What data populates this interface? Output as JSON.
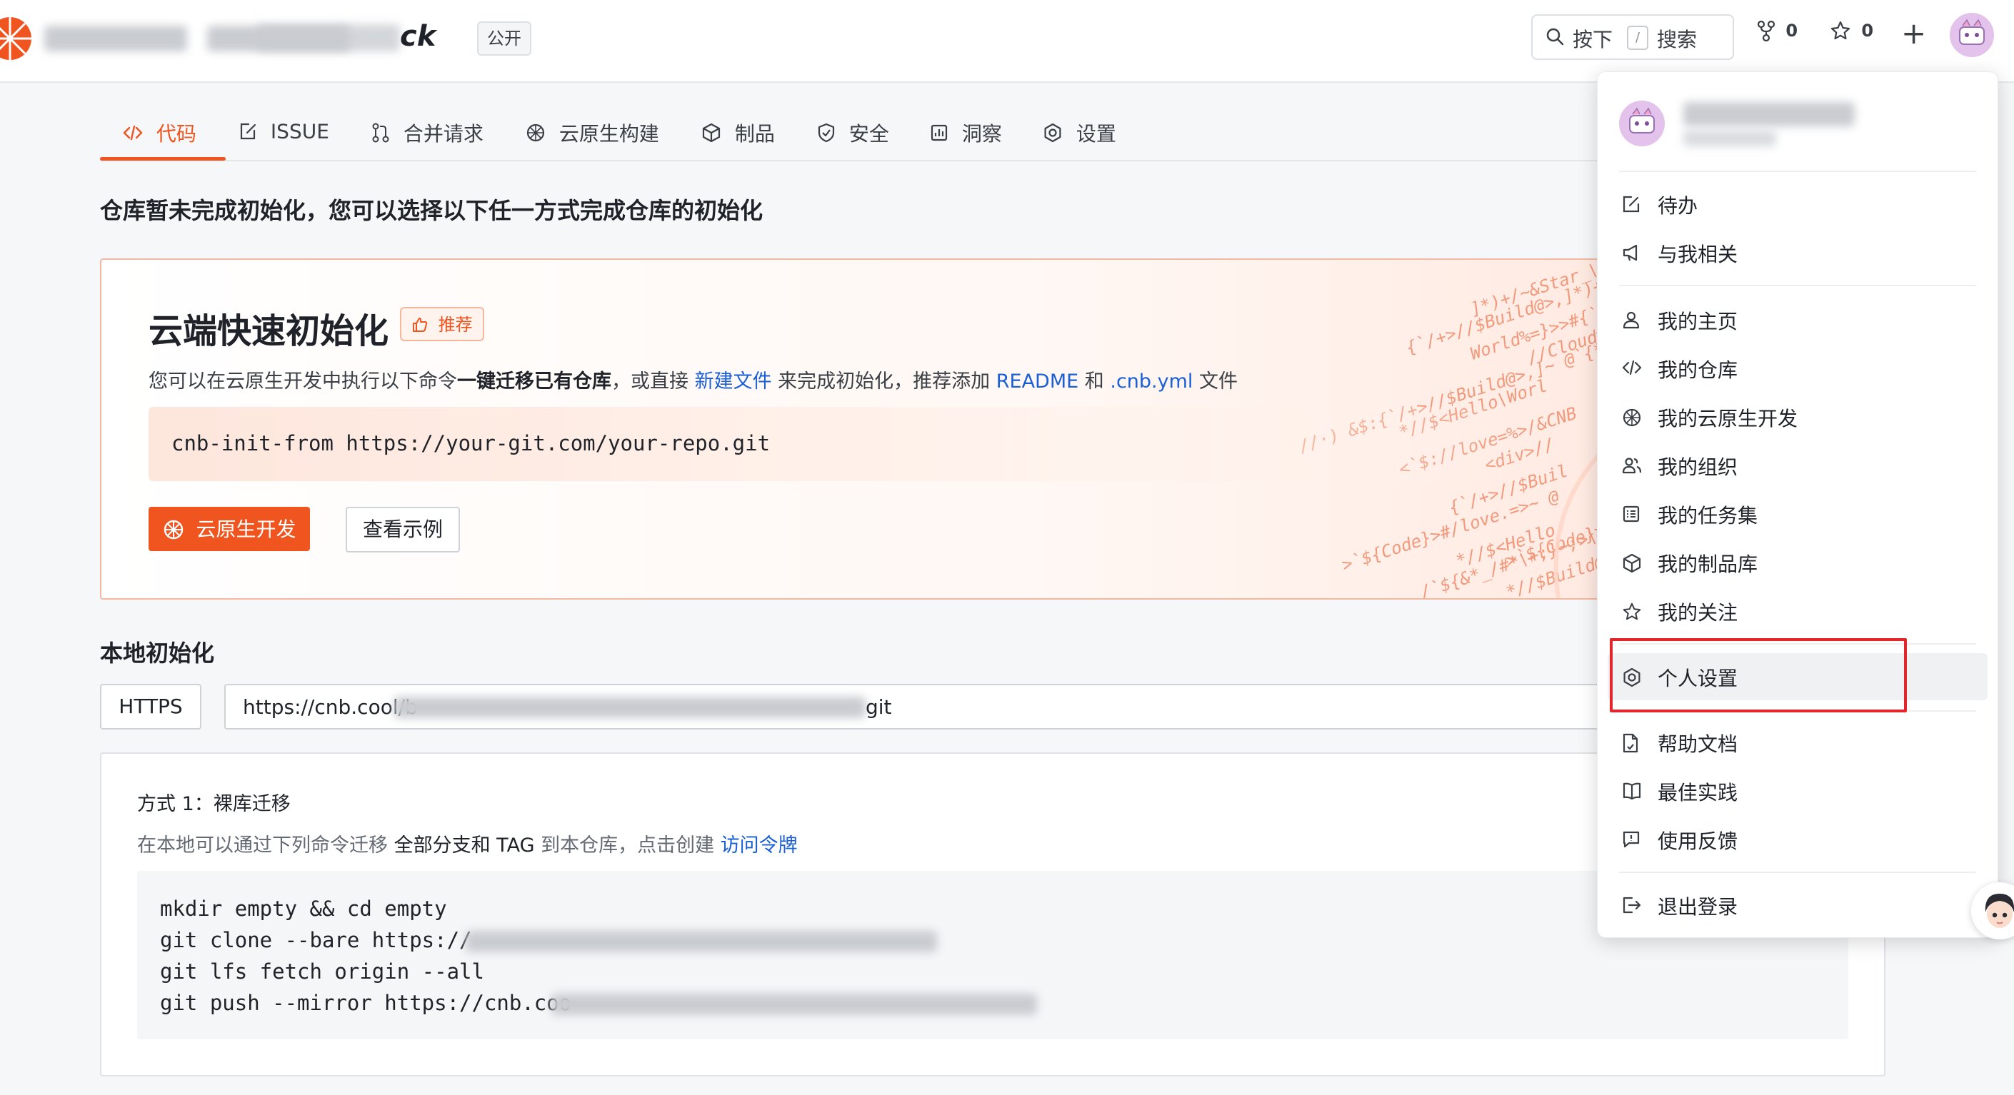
{
  "header": {
    "repo_name_tail": "ck",
    "visibility_badge": "公开",
    "search_prefix": "按下",
    "search_key": "/",
    "search_label": "搜索",
    "fork_count": "0",
    "star_count": "0",
    "plus": "+"
  },
  "tabs": [
    {
      "label": "代码",
      "icon": "code-icon",
      "active": true
    },
    {
      "label": "ISSUE",
      "icon": "issue-icon"
    },
    {
      "label": "合并请求",
      "icon": "pull-request-icon"
    },
    {
      "label": "云原生构建",
      "icon": "build-icon"
    },
    {
      "label": "制品",
      "icon": "package-icon"
    },
    {
      "label": "安全",
      "icon": "shield-icon"
    },
    {
      "label": "洞察",
      "icon": "chart-icon"
    },
    {
      "label": "设置",
      "icon": "gear-icon"
    }
  ],
  "init_notice": "仓库暂未完成初始化，您可以选择以下任一方式完成仓库的初始化",
  "cloud_init": {
    "title": "云端快速初始化",
    "badge": "推荐",
    "desc_prefix": "您可以在云原生开发中执行以下命令",
    "desc_bold": "一键迁移已有仓库",
    "desc_mid": "，或直接 ",
    "desc_link1": "新建文件",
    "desc_mid2": " 来完成初始化，推荐添加 ",
    "desc_link2": "README",
    "desc_and": " 和 ",
    "desc_link3": ".cnb.yml",
    "desc_suffix": " 文件",
    "command": "cnb-init-from https://your-git.com/your-repo.git",
    "primary_button": "云原生开发",
    "secondary_button": "查看示例"
  },
  "local_init": {
    "title": "本地初始化",
    "protocol": "HTTPS",
    "url_prefix": "https://cnb.cool/b",
    "url_suffix": "git",
    "method_title": "方式 1：裸库迁移",
    "method_desc_prefix": "在本地可以通过下列命令迁移 ",
    "method_desc_bold": "全部分支和 TAG",
    "method_desc_mid": " 到本仓库，点击创建 ",
    "method_desc_link": "访问令牌",
    "code_lines": [
      "mkdir empty && cd empty",
      "git clone --bare https://",
      "git lfs fetch origin --all",
      "git push --mirror https://cnb.coo"
    ]
  },
  "user_menu": {
    "groups": [
      [
        {
          "label": "待办",
          "icon": "edit-icon"
        },
        {
          "label": "与我相关",
          "icon": "megaphone-icon"
        }
      ],
      [
        {
          "label": "我的主页",
          "icon": "user-icon"
        },
        {
          "label": "我的仓库",
          "icon": "code-icon"
        },
        {
          "label": "我的云原生开发",
          "icon": "build-icon"
        },
        {
          "label": "我的组织",
          "icon": "group-icon"
        },
        {
          "label": "我的任务集",
          "icon": "list-icon"
        },
        {
          "label": "我的制品库",
          "icon": "package-icon"
        },
        {
          "label": "我的关注",
          "icon": "star-icon"
        }
      ],
      [
        {
          "label": "个人设置",
          "icon": "gear-icon",
          "highlighted": true
        }
      ],
      [
        {
          "label": "帮助文档",
          "icon": "doc-icon"
        },
        {
          "label": "最佳实践",
          "icon": "book-icon"
        },
        {
          "label": "使用反馈",
          "icon": "feedback-icon"
        }
      ],
      [
        {
          "label": "退出登录",
          "icon": "logout-icon"
        }
      ]
    ]
  },
  "colors": {
    "accent": "#f0541f",
    "link": "#1a5fd6",
    "highlight_box": "#e3262b"
  }
}
